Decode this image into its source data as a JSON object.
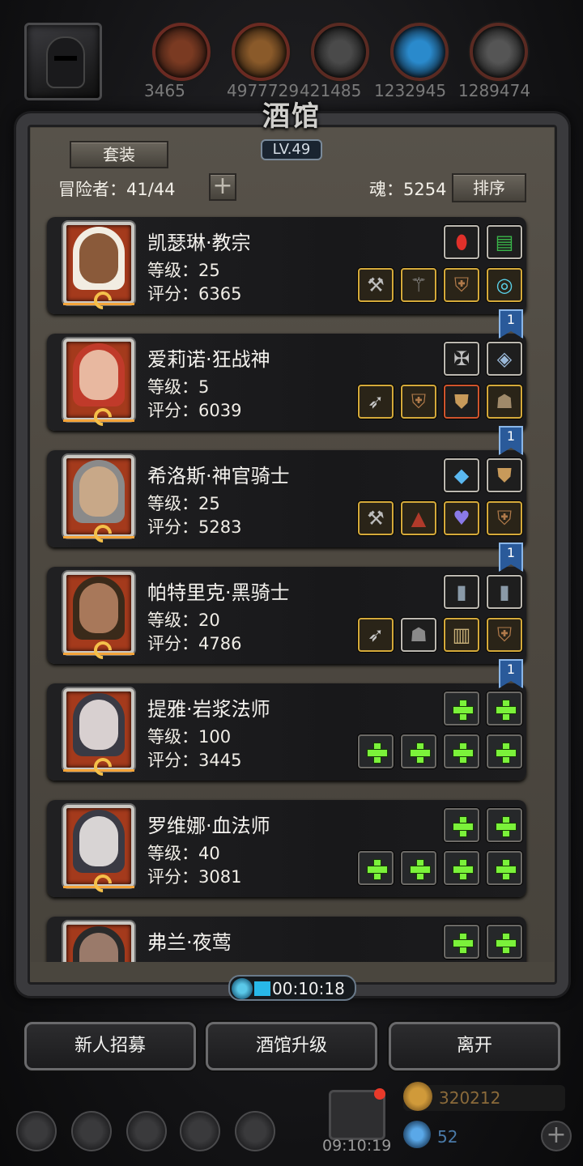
{
  "resources": [
    "3465",
    "4977729",
    "421485",
    "1232945",
    "1289474"
  ],
  "panel": {
    "title": "酒馆",
    "level": "LV.49",
    "set_label": "套装",
    "adventurers_label": "冒险者：41/44",
    "soul_label": "魂：5254",
    "sort_label": "排序",
    "plus_label": "+"
  },
  "heroes": [
    {
      "name": "凯瑟琳·教宗",
      "level": "等级：25",
      "score": "评分：6365",
      "top_slots": [
        "red-gem-icon",
        "green-scroll-icon"
      ],
      "bottom_slots": [
        "hammer-icon",
        "staff-icon",
        "armor-icon",
        "ring-icon"
      ],
      "bookmark": ""
    },
    {
      "name": "爱莉诺·狂战神",
      "level": "等级：5",
      "score": "评分：6039",
      "top_slots": [
        "emblem-icon",
        "amulet-icon"
      ],
      "bottom_slots": [
        "spear-icon",
        "armor-icon",
        "shield-icon",
        "mask-icon"
      ],
      "bookmark": "1"
    },
    {
      "name": "希洛斯·神官骑士",
      "level": "等级：25",
      "score": "评分：5283",
      "top_slots": [
        "crystal-icon",
        "shield-icon"
      ],
      "bottom_slots": [
        "hammer-icon",
        "robe-icon",
        "heart-icon",
        "armor-icon"
      ],
      "bookmark": "1"
    },
    {
      "name": "帕特里克·黑骑士",
      "level": "等级：20",
      "score": "评分：4786",
      "top_slots": [
        "tablet-icon",
        "tablet-icon"
      ],
      "bottom_slots": [
        "spear-icon",
        "helmet-icon",
        "scroll-icon",
        "armor-icon"
      ],
      "bookmark": "1"
    },
    {
      "name": "提雅·岩浆法师",
      "level": "等级：100",
      "score": "评分：3445",
      "top_slots": [
        "empty",
        "empty"
      ],
      "bottom_slots": [
        "empty",
        "empty",
        "empty",
        "empty"
      ],
      "bookmark": "1"
    },
    {
      "name": "罗维娜·血法师",
      "level": "等级：40",
      "score": "评分：3081",
      "top_slots": [
        "empty",
        "empty"
      ],
      "bottom_slots": [
        "empty",
        "empty",
        "empty",
        "empty"
      ],
      "bookmark": ""
    },
    {
      "name": "弗兰·夜莺",
      "level": "",
      "score": "",
      "top_slots": [
        "empty",
        "empty"
      ],
      "bottom_slots": [],
      "bookmark": ""
    }
  ],
  "timer": "00:10:18",
  "buttons": {
    "recruit": "新人招募",
    "upgrade": "酒馆升级",
    "leave": "离开"
  },
  "footer": {
    "gift_timer": "09:10:19",
    "gold": "320212",
    "gems": "52"
  }
}
